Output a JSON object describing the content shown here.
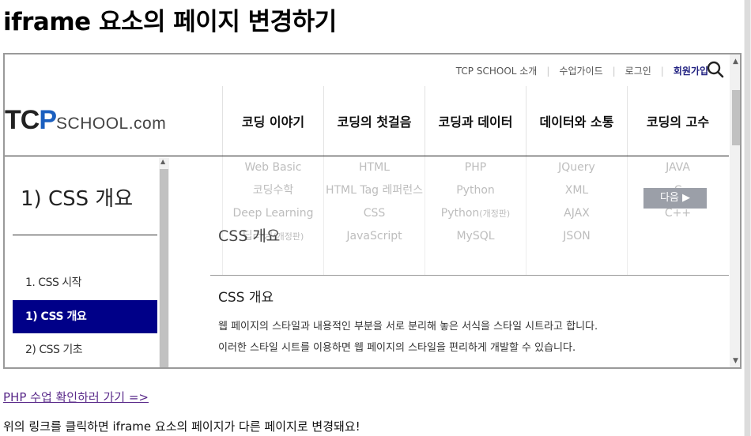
{
  "page": {
    "title": "iframe 요소의 페이지 변경하기",
    "link_text": "PHP 수업 확인하러 가기 =>",
    "description": "위의 링크를 클릭하면 iframe 요소의 페이지가 다른 페이지로 변경돼요!"
  },
  "iframe": {
    "top_links": [
      "TCP SCHOOL 소개",
      "수업가이드",
      "로그인",
      "회원가입"
    ],
    "logo": {
      "tc": "TC",
      "p": "P",
      "school": "SCHOOL.com"
    },
    "nav": [
      "코딩 이야기",
      "코딩의 첫걸음",
      "코딩과 데이터",
      "데이터와 소통",
      "코딩의 고수"
    ],
    "dropdown": [
      [
        "Web Basic",
        "코딩수학",
        "Deep Learning",
        "딥러닝"
      ],
      [
        "HTML",
        "HTML Tag 레퍼런스",
        "CSS",
        "JavaScript"
      ],
      [
        "PHP",
        "Python",
        "Python",
        "MySQL"
      ],
      [
        "JQuery",
        "XML",
        "AJAX",
        "JSON"
      ],
      [
        "JAVA",
        "C",
        "C++"
      ]
    ],
    "dropdown_suffix": "(개정판)",
    "next_button": "다음 ▶",
    "sidebar": {
      "title": "1) CSS 개요",
      "items": [
        "1. CSS 시작",
        "1) CSS 개요",
        "2) CSS 기초"
      ],
      "active_index": 1
    },
    "content": {
      "heading": "CSS 개요",
      "subtitle": "CSS 개요",
      "lines": [
        "웹 페이지의 스타일과 내용적인 부분을 서로 분리해 놓은 서식을 스타일 시트라고 합니다.",
        "이러한 스타일 시트를 이용하면 웹 페이지의 스타일을 편리하게 개발할 수 있습니다."
      ]
    }
  },
  "colors": {
    "sidebar_active": "#000088",
    "logo_accent": "#1b5fbf",
    "link": "#5a2a8a",
    "join_link": "#202080"
  },
  "icons": {
    "search": "search-icon"
  }
}
